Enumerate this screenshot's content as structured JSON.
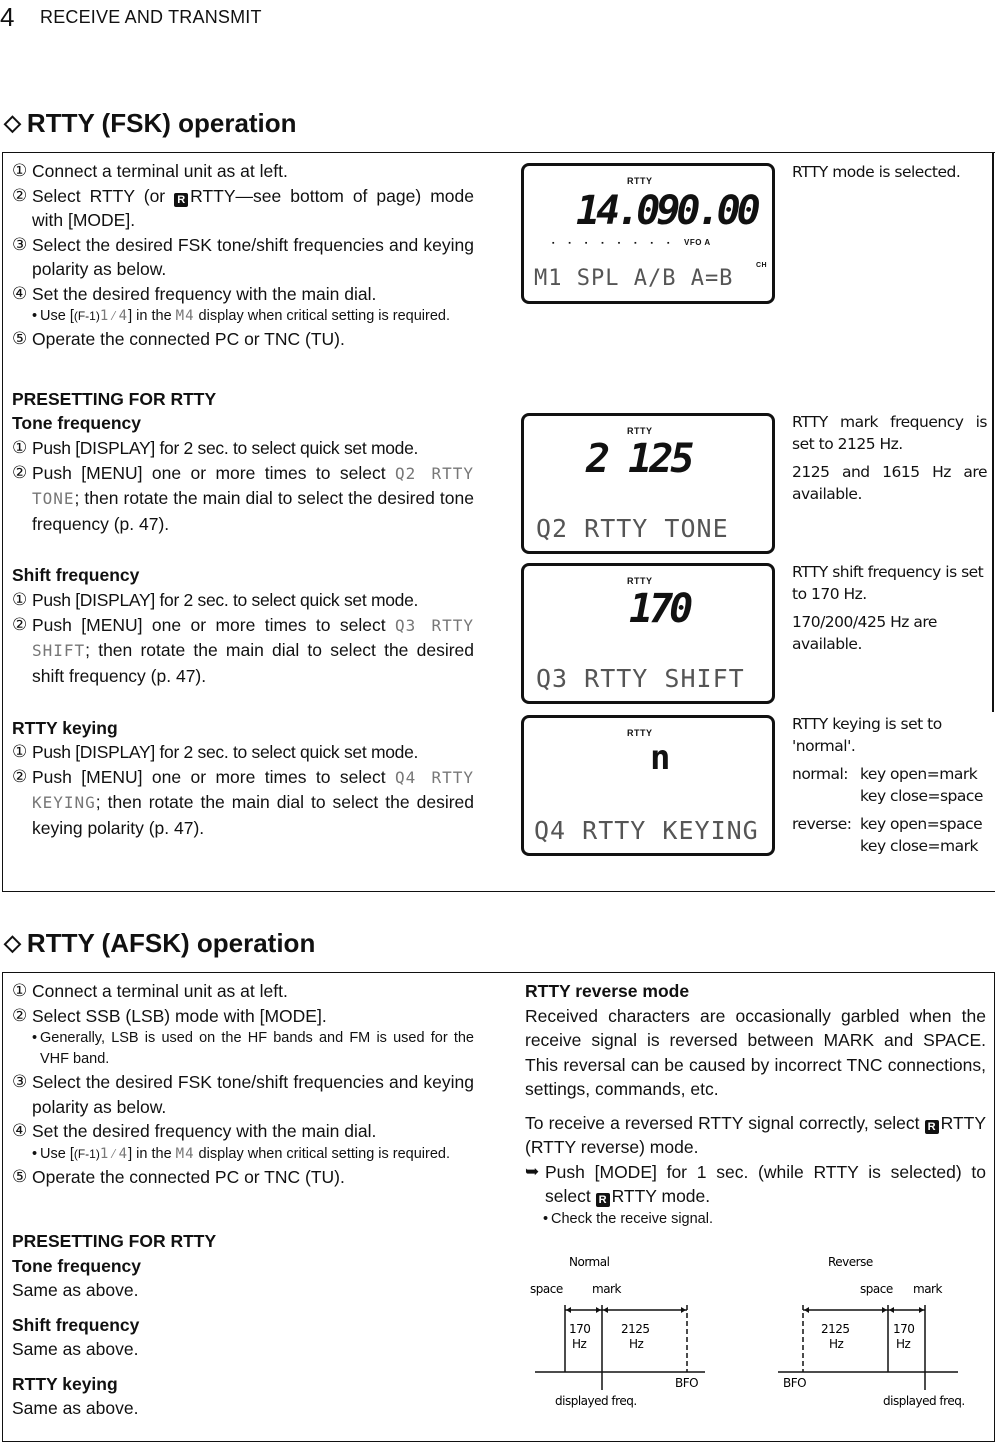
{
  "header": {
    "chapter_number": "4",
    "chapter_title": "RECEIVE AND TRANSMIT"
  },
  "fsk": {
    "title": "RTTY (FSK) operation",
    "steps": [
      {
        "num": "①",
        "text": "Connect a terminal unit as at left."
      },
      {
        "num": "②",
        "pre": "Select RTTY (or ",
        "icon": "R",
        "post": "RTTY—see bottom of page) mode with [MODE]."
      },
      {
        "num": "③",
        "text": "Select the desired FSK tone/shift frequencies and keying polarity as below."
      },
      {
        "num": "④",
        "text": "Set the desired frequency with the main dial."
      },
      {
        "num": "⑤",
        "text": "Operate the connected PC or TNC (TU)."
      }
    ],
    "note": {
      "bullet": "•",
      "pre": "Use [",
      "key_small": "(F-1)",
      "key_lcd": "1⁄4",
      "mid": "] in the ",
      "lcd_name": "M4",
      "post": " display when critical setting is required."
    },
    "presetting_title": "PRESETTING FOR RTTY",
    "tone": {
      "title": "Tone frequency",
      "step1": {
        "num": "①",
        "text": "Push [DISPLAY] for 2 sec. to select quick set mode."
      },
      "step2": {
        "num": "②",
        "pre": "Push [MENU] one or more times to select ",
        "lcd": "Q2 RTTY TONE",
        "post": "; then rotate the main dial to select the desired tone frequency (p. 47)."
      }
    },
    "shift": {
      "title": "Shift frequency",
      "step1": {
        "num": "①",
        "text": "Push [DISPLAY] for 2 sec. to select quick set mode."
      },
      "step2": {
        "num": "②",
        "pre": "Push [MENU] one or more times to select ",
        "lcd": "Q3 RTTY SHIFT",
        "post": "; then rotate the main dial to select the desired shift frequency (p. 47)."
      }
    },
    "keying": {
      "title": "RTTY keying",
      "step1": {
        "num": "①",
        "text": "Push [DISPLAY] for 2 sec. to select quick set mode."
      },
      "step2": {
        "num": "②",
        "pre": "Push [MENU] one or more times to select ",
        "lcd": "Q4 RTTY KEYING",
        "post": "; then rotate the main dial to select the desired keying polarity (p. 47)."
      }
    },
    "displays": [
      {
        "mode": "RTTY",
        "value": "14.090.00",
        "indicators": "VFO A",
        "ch": "CH",
        "bottom": "M1 SPL A/B A=B",
        "caption": [
          "RTTY mode is selected."
        ]
      },
      {
        "mode": "RTTY",
        "value": "2 125",
        "bottom": "Q2 RTTY TONE",
        "caption": [
          "RTTY mark frequency is set to 2125 Hz.",
          "2125 and 1615 Hz are available."
        ]
      },
      {
        "mode": "RTTY",
        "value": "170",
        "bottom": "Q3 RTTY SHIFT",
        "caption": [
          "RTTY shift frequency is set to 170 Hz.",
          "170/200/425 Hz are available."
        ]
      },
      {
        "mode": "RTTY",
        "value": "n",
        "bottom": "Q4 RTTY KEYING",
        "caption": [
          "RTTY keying is set to 'normal'."
        ],
        "keying_table": [
          {
            "label": "normal:",
            "lines": [
              "key open=mark",
              "key close=space"
            ]
          },
          {
            "label": "reverse:",
            "lines": [
              "key open=space",
              "key close=mark"
            ]
          }
        ]
      }
    ]
  },
  "afsk": {
    "title": "RTTY (AFSK) operation",
    "steps": [
      {
        "num": "①",
        "text": "Connect a terminal unit as at left."
      },
      {
        "num": "②",
        "text": "Select SSB (LSB) mode with [MODE]."
      },
      {
        "num": "③",
        "text": "Select the desired FSK tone/shift frequencies and keying polarity as below."
      },
      {
        "num": "④",
        "text": "Set the desired frequency with the main dial."
      },
      {
        "num": "⑤",
        "text": "Operate the connected PC or TNC (TU)."
      }
    ],
    "note_lsb": "Generally, LSB is used on the HF bands and FM is used for the VHF band.",
    "presetting_title": "PRESETTING FOR RTTY",
    "tone_title": "Tone frequency",
    "tone_text": "Same as above.",
    "shift_title": "Shift frequency",
    "shift_text": "Same as above.",
    "keying_title": "RTTY keying",
    "keying_text": "Same as above.",
    "reverse": {
      "title": "RTTY reverse mode",
      "para1": "Received characters are occasionally garbled when the receive signal is reversed between MARK and SPACE. This reversal can be caused by incorrect TNC connections, settings, commands, etc.",
      "para2_pre": "To receive a reversed RTTY signal correctly, select ",
      "para2_post": "RTTY (RTTY reverse) mode.",
      "arrow": "➥",
      "instr_pre": "Push [MODE] for 1 sec. (while RTTY is selected) to select ",
      "instr_post": "RTTY mode.",
      "check": "Check the receive signal.",
      "icon": "R"
    },
    "diagrams": {
      "normal": {
        "title": "Normal",
        "space": "space",
        "mark": "mark",
        "shift": "170",
        "tone": "2125",
        "unit": "Hz",
        "bfo": "BFO",
        "displayed": "displayed freq."
      },
      "reverse": {
        "title": "Reverse",
        "space": "space",
        "mark": "mark",
        "shift": "170",
        "tone": "2125",
        "unit": "Hz",
        "bfo": "BFO",
        "displayed": "displayed freq."
      }
    }
  }
}
